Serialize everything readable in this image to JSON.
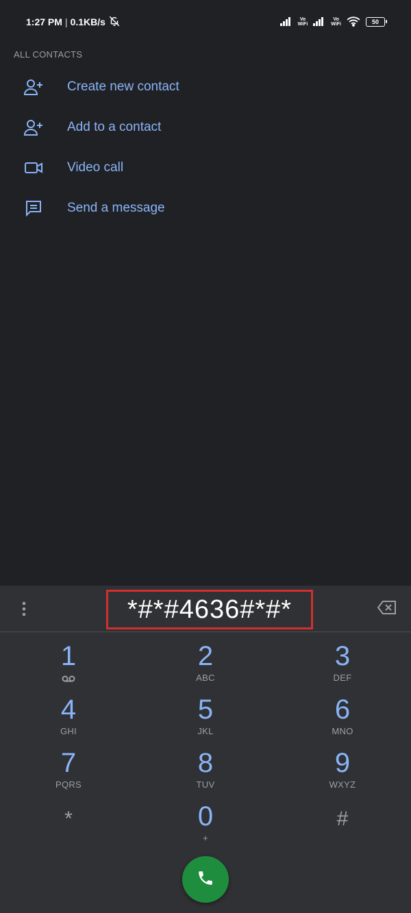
{
  "status_bar": {
    "time": "1:27 PM",
    "separator": "|",
    "network_speed": "0.1KB/s",
    "vowifi_1": "Vo\nWiFi",
    "vowifi_2": "Vo\nWiFi",
    "battery": "50"
  },
  "contacts": {
    "section_header": "ALL CONTACTS",
    "actions": [
      {
        "label": "Create new contact",
        "icon": "person-add-icon"
      },
      {
        "label": "Add to a contact",
        "icon": "person-add-icon"
      },
      {
        "label": "Video call",
        "icon": "video-call-icon"
      },
      {
        "label": "Send a message",
        "icon": "message-icon"
      }
    ]
  },
  "dialer": {
    "digits": "*#*#4636#*#*",
    "keys": [
      {
        "num": "1",
        "sub": "voicemail-icon"
      },
      {
        "num": "2",
        "sub": "ABC"
      },
      {
        "num": "3",
        "sub": "DEF"
      },
      {
        "num": "4",
        "sub": "GHI"
      },
      {
        "num": "5",
        "sub": "JKL"
      },
      {
        "num": "6",
        "sub": "MNO"
      },
      {
        "num": "7",
        "sub": "PQRS"
      },
      {
        "num": "8",
        "sub": "TUV"
      },
      {
        "num": "9",
        "sub": "WXYZ"
      },
      {
        "num": "*",
        "sub": ""
      },
      {
        "num": "0",
        "sub": "+"
      },
      {
        "num": "#",
        "sub": ""
      }
    ]
  },
  "colors": {
    "background": "#202124",
    "dialer_background": "#303134",
    "accent_blue": "#8ab4f8",
    "call_green": "#1e8e3e",
    "highlight_red": "#d32f2f"
  }
}
